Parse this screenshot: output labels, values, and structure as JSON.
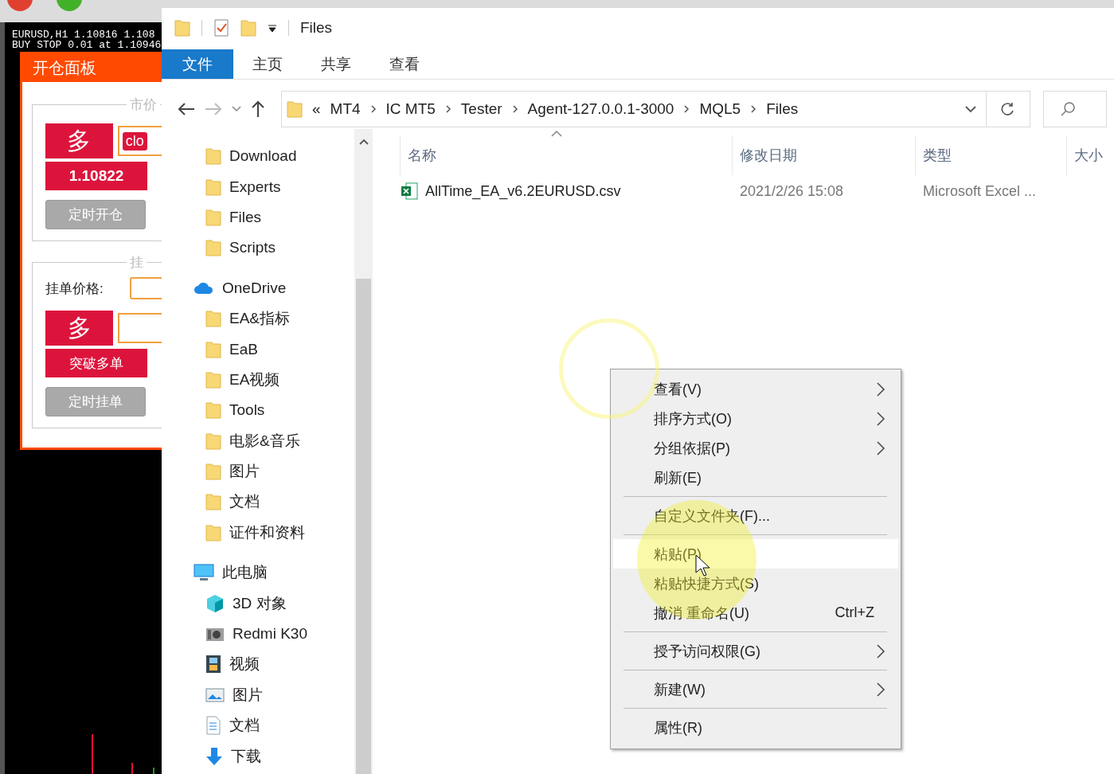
{
  "chart": {
    "lines": [
      "EURUSD,H1  1.10816 1.108",
      "BUY STOP 0.01 at 1.10946"
    ]
  },
  "order_panel": {
    "title": "开仓面板",
    "market_group": {
      "legend": "市价",
      "buy_label": "多",
      "tag": "clo",
      "price": "1.10822",
      "timer_button": "定时开仓"
    },
    "pending_group": {
      "legend": "挂",
      "price_label": "挂单价格:",
      "buy_label": "多",
      "breakout_button": "突破多单",
      "timer_button": "定时挂单"
    }
  },
  "explorer": {
    "title": "Files",
    "ribbon_tabs": [
      {
        "label": "文件",
        "selected": true
      },
      {
        "label": "主页",
        "selected": false
      },
      {
        "label": "共享",
        "selected": false
      },
      {
        "label": "查看",
        "selected": false
      }
    ],
    "address": {
      "overflow": "«",
      "segments": [
        "MT4",
        "IC MT5",
        "Tester",
        "Agent-127.0.0.1-3000",
        "MQL5",
        "Files"
      ]
    },
    "navigation": [
      {
        "label": "Download",
        "kind": "folder"
      },
      {
        "label": "Experts",
        "kind": "folder"
      },
      {
        "label": "Files",
        "kind": "folder"
      },
      {
        "label": "Scripts",
        "kind": "folder"
      },
      {
        "label": "OneDrive",
        "kind": "cloud",
        "children": [
          {
            "label": "EA&指标",
            "kind": "folder"
          },
          {
            "label": "EaB",
            "kind": "folder"
          },
          {
            "label": "EA视频",
            "kind": "folder"
          },
          {
            "label": "Tools",
            "kind": "folder"
          },
          {
            "label": "电影&音乐",
            "kind": "folder"
          },
          {
            "label": "图片",
            "kind": "folder"
          },
          {
            "label": "文档",
            "kind": "folder"
          },
          {
            "label": "证件和资料",
            "kind": "folder"
          }
        ]
      },
      {
        "label": "此电脑",
        "kind": "pc",
        "children": [
          {
            "label": "3D 对象",
            "kind": "cube"
          },
          {
            "label": "Redmi K30",
            "kind": "camera"
          },
          {
            "label": "视频",
            "kind": "film"
          },
          {
            "label": "图片",
            "kind": "image"
          },
          {
            "label": "文档",
            "kind": "document"
          },
          {
            "label": "下载",
            "kind": "download"
          }
        ]
      }
    ],
    "columns": [
      "名称",
      "修改日期",
      "类型",
      "大小"
    ],
    "files": [
      {
        "name": "AllTime_EA_v6.2EURUSD.csv",
        "modified": "2021/2/26 15:08",
        "type": "Microsoft Excel ..."
      }
    ]
  },
  "context_menu": {
    "items": [
      {
        "kind": "item",
        "label": "查看(V)",
        "submenu": true,
        "selected": false
      },
      {
        "kind": "item",
        "label": "排序方式(O)",
        "submenu": true,
        "selected": false
      },
      {
        "kind": "item",
        "label": "分组依据(P)",
        "submenu": true,
        "selected": false
      },
      {
        "kind": "item",
        "label": "刷新(E)",
        "submenu": false,
        "selected": false
      },
      {
        "kind": "separator"
      },
      {
        "kind": "item",
        "label": "自定义文件夹(F)...",
        "submenu": false,
        "selected": false
      },
      {
        "kind": "separator"
      },
      {
        "kind": "item",
        "label": "粘贴(P)",
        "submenu": false,
        "selected": true
      },
      {
        "kind": "item",
        "label": "粘贴快捷方式(S)",
        "submenu": false,
        "selected": false
      },
      {
        "kind": "item",
        "label": "撤消 重命名(U)",
        "shortcut": "Ctrl+Z",
        "submenu": false,
        "selected": false
      },
      {
        "kind": "separator"
      },
      {
        "kind": "item",
        "label": "授予访问权限(G)",
        "submenu": true,
        "selected": false
      },
      {
        "kind": "separator"
      },
      {
        "kind": "item",
        "label": "新建(W)",
        "submenu": true,
        "selected": false
      },
      {
        "kind": "separator"
      },
      {
        "kind": "item",
        "label": "属性(R)",
        "submenu": false,
        "selected": false
      }
    ]
  }
}
